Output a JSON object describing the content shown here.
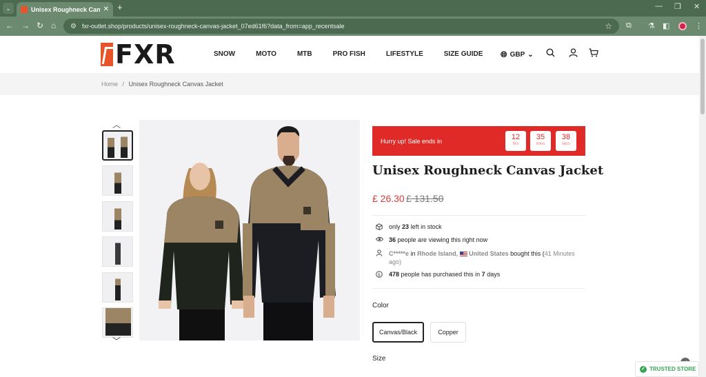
{
  "browser": {
    "tab_title": "Unisex Roughneck Canvas Jack",
    "url": "fxr-outlet.shop/products/unisex-roughneck-canvas-jacket_07ed61f6?data_from=app_recentsale"
  },
  "header": {
    "logo_text": "FXR",
    "nav": [
      "SNOW",
      "MOTO",
      "MTB",
      "PRO FISH",
      "LIFESTYLE",
      "SIZE GUIDE"
    ],
    "currency": "GBP"
  },
  "breadcrumb": {
    "home": "Home",
    "separator": "/",
    "current": "Unisex Roughneck Canvas Jacket"
  },
  "sale": {
    "text": "Hurry up!  Sale ends in",
    "hours": "12",
    "hours_label": "hrs",
    "mins": "35",
    "mins_label": "mins",
    "secs": "38",
    "secs_label": "secs"
  },
  "product": {
    "title": "Unisex Roughneck Canvas Jacket",
    "price": "£ 26.30",
    "compare_price": "£ 131.50"
  },
  "info": {
    "stock_pre": "only",
    "stock_count": "23",
    "stock_post": "left in stock",
    "viewing_count": "36",
    "viewing_text": "people are viewing this right now",
    "buyer_name": "C*****e",
    "buyer_in": "in",
    "buyer_region": "Rhode Island,",
    "buyer_country": "United States",
    "buyer_bought": "bought this (",
    "buyer_time": "41 Minutes",
    "buyer_ago": "ago)",
    "purchased_count": "478",
    "purchased_text": "people has purchased this in",
    "purchased_days": "7",
    "purchased_unit": "days"
  },
  "options": {
    "color_label": "Color",
    "colors": [
      "Canvas/Black",
      "Copper"
    ],
    "size_label": "Size"
  },
  "badges": {
    "trusted": "TRUSTED STORE"
  }
}
